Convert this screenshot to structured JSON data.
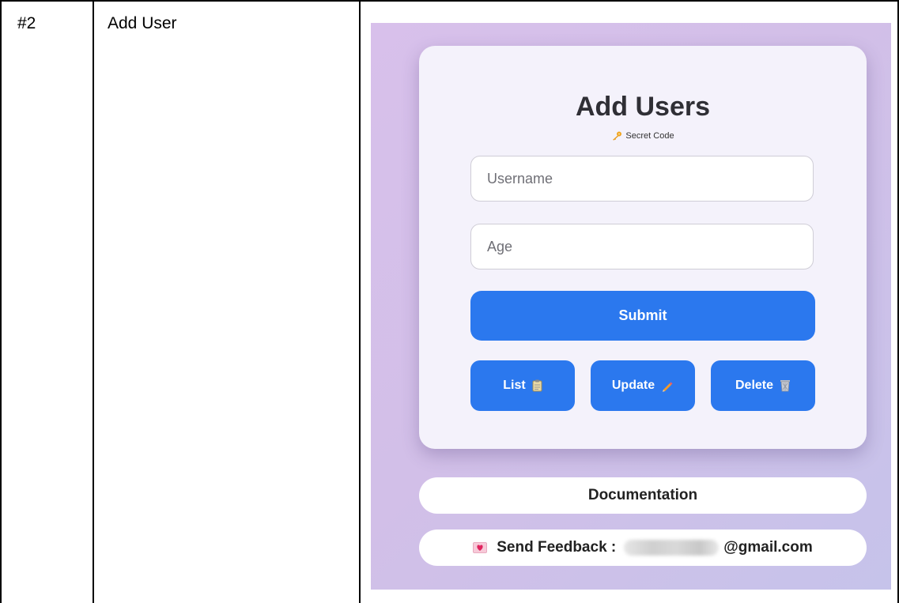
{
  "table": {
    "row_number": "#2",
    "feature_name": "Add User"
  },
  "app": {
    "title": "Add Users",
    "secret_code_label": "Secret Code",
    "username_placeholder": "Username",
    "age_placeholder": "Age",
    "submit_label": "Submit",
    "list_label": "List",
    "update_label": "Update",
    "delete_label": "Delete",
    "documentation_label": "Documentation",
    "feedback_label": "Send Feedback :",
    "feedback_email_domain": "@gmail.com",
    "icons": {
      "secret": "key-icon",
      "list": "clipboard-icon",
      "update": "pencil-icon",
      "delete": "wastebasket-icon",
      "feedback": "heart-envelope-icon"
    },
    "colors": {
      "button_blue": "#2b78ee",
      "card_background": "#f4f2fb",
      "panel_gradient_start": "#d8c0eb",
      "panel_gradient_end": "#c6c3ea"
    }
  }
}
